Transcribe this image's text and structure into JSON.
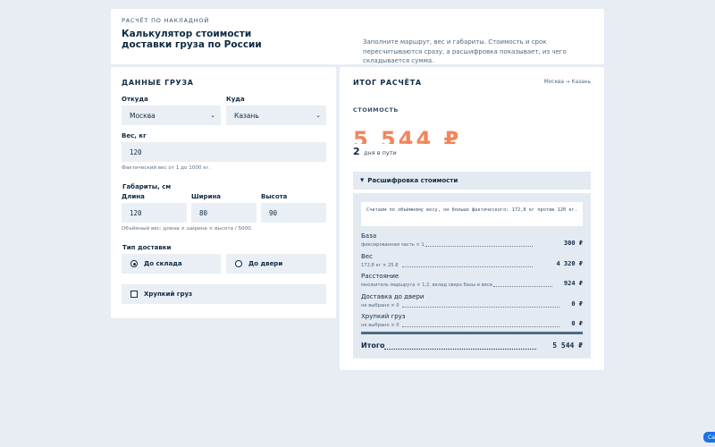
{
  "header": {
    "kicker": "РАСЧЁТ ПО НАКЛАДНОЙ",
    "title": "Калькулятор стоимости доставки груза по России",
    "subtitle": "Заполните маршрут, вес и габариты. Стоимость и срок пересчитываются сразу, а расшифровка показывает, из чего складывается сумма."
  },
  "form": {
    "section_title": "ДАННЫЕ ГРУЗА",
    "from": {
      "label": "Откуда",
      "value": "Москва"
    },
    "to": {
      "label": "Куда",
      "value": "Казань"
    },
    "weight": {
      "label": "Вес, кг",
      "value": "120",
      "hint": "Фактический вес от 1 до 1000 кг."
    },
    "dims": {
      "label": "Габариты, см",
      "length": {
        "label": "Длина",
        "value": "120"
      },
      "width": {
        "label": "Ширина",
        "value": "80"
      },
      "height": {
        "label": "Высота",
        "value": "90"
      },
      "hint": "Объёмный вес: длина × ширина × высота / 5000."
    },
    "delivery": {
      "label": "Тип доставки",
      "options": [
        {
          "label": "До склада",
          "selected": true
        },
        {
          "label": "До двери",
          "selected": false
        }
      ]
    },
    "fragile": {
      "label": "Хрупкий груз",
      "checked": false
    }
  },
  "result": {
    "section_title": "ИТОГ РАСЧЁТА",
    "route": "Москва → Казань",
    "cost_label": "СТОИМОСТЬ",
    "price": "5 544 ₽",
    "days": "2",
    "days_text": "дня в пути",
    "breakdown_title": "Расшифровка стоимости",
    "note": "Считаем по объёмному весу, он больше фактического: 172,8 кг против 120 кг.",
    "rows": [
      {
        "title": "База",
        "sub": "фиксированная часть × 1",
        "value": "300 ₽"
      },
      {
        "title": "Вес",
        "sub": "172,8 кг × 25 ₽",
        "value": "4 320 ₽"
      },
      {
        "title": "Расстояние",
        "sub": "множитель маршрута × 1,2, вклад сверх базы и веса",
        "value": "924 ₽"
      },
      {
        "title": "Доставка до двери",
        "sub": "не выбрано × 0",
        "value": "0 ₽"
      },
      {
        "title": "Хрупкий груз",
        "sub": "не выбрано × 0",
        "value": "0 ₽"
      }
    ],
    "total_label": "Итого",
    "total_value": "5 544 ₽"
  },
  "corner_button": {
    "label": "Ca"
  }
}
